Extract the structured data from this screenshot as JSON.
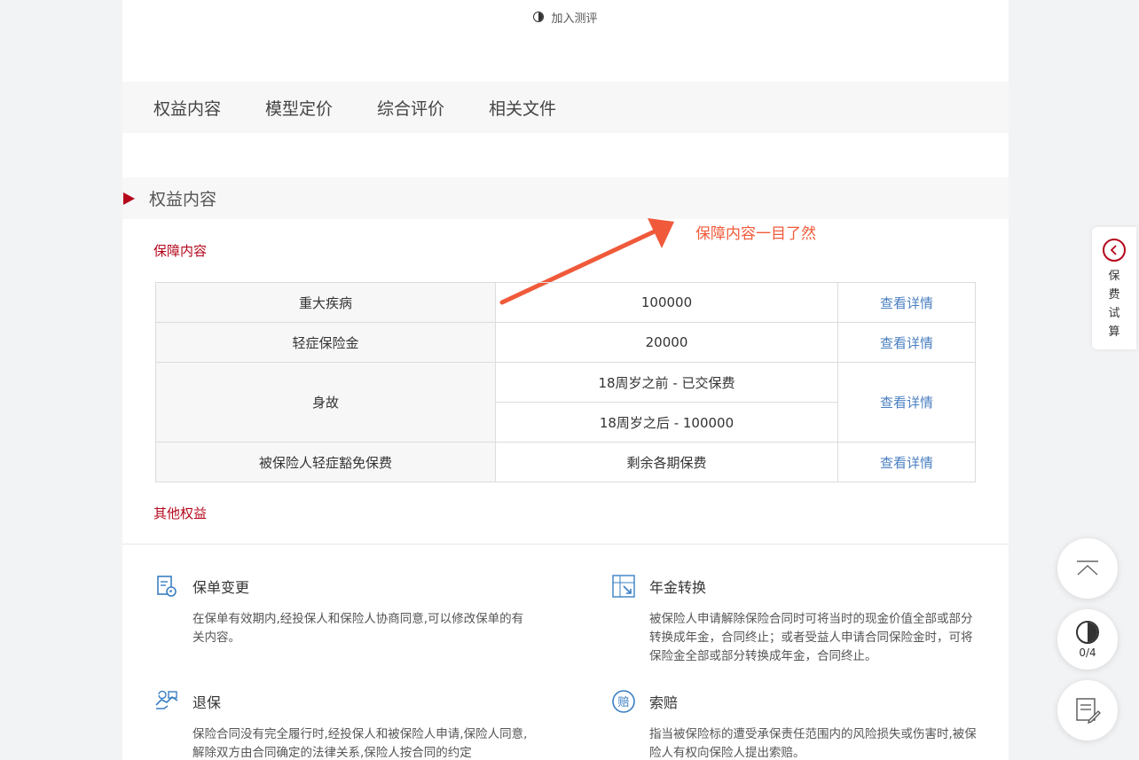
{
  "compare_top": {
    "label": "加入测评",
    "icon": "half-circle-icon"
  },
  "tabs": [
    {
      "label": "权益内容"
    },
    {
      "label": "模型定价"
    },
    {
      "label": "综合评价"
    },
    {
      "label": "相关文件"
    }
  ],
  "section": {
    "title": "权益内容"
  },
  "annotation": {
    "text": "保障内容一目了然",
    "color": "#f05a3a"
  },
  "coverage": {
    "title": "保障内容",
    "detail_label": "查看详情",
    "rows": [
      {
        "name": "重大疾病",
        "value": "100000"
      },
      {
        "name": "轻症保险金",
        "value": "20000"
      },
      {
        "name": "身故",
        "value_a": "18周岁之前 - 已交保费",
        "value_b": "18周岁之后 - 100000"
      },
      {
        "name": "被保险人轻症豁免保费",
        "value": "剩余各期保费"
      }
    ]
  },
  "other": {
    "title": "其他权益",
    "items": [
      {
        "title": "保单变更",
        "icon": "policy-change-icon",
        "desc": "在保单有效期内,经投保人和保险人协商同意,可以修改保单的有关内容。"
      },
      {
        "title": "年金转换",
        "icon": "annuity-convert-icon",
        "desc": "被保险人申请解除保险合同时可将当时的现金价值全部或部分转换成年金，合同终止；或者受益人申请合同保险金时，可将保险金全部或部分转换成年金，合同终止。"
      },
      {
        "title": "退保",
        "icon": "surrender-icon",
        "desc": "保险合同没有完全履行时,经投保人和被保险人申请,保险人同意,解除双方由合同确定的法律关系,保险人按合同的约定"
      },
      {
        "title": "索赔",
        "icon": "claim-icon",
        "icon_char": "赔",
        "desc": "指当被保险标的遭受承保责任范围内的风险损失或伤害时,被保险人有权向保险人提出索赔。"
      }
    ]
  },
  "side_calc": {
    "label": "保费试算"
  },
  "fabs": {
    "compare_count": "0/4"
  },
  "colors": {
    "brand_red": "#b5061b",
    "link_blue": "#4a7fc1"
  }
}
